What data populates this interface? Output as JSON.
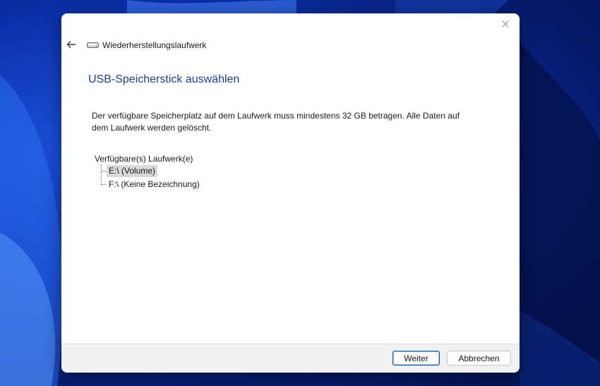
{
  "window": {
    "title": "Wiederherstellungslaufwerk",
    "close_icon": "close-icon",
    "back_icon": "back-arrow-icon",
    "drive_icon": "drive-icon"
  },
  "main": {
    "heading": "USB-Speicherstick auswählen",
    "info": "Der verfügbare Speicherplatz auf dem Laufwerk muss mindestens 32 GB betragen. Alle Daten auf dem Laufwerk werden gelöscht.",
    "drives_label": "Verfügbare(s) Laufwerk(e)",
    "drives": [
      {
        "label": "E:\\ (Volume)",
        "selected": true
      },
      {
        "label": "F:\\ (Keine Bezeichnung)",
        "selected": false
      }
    ]
  },
  "footer": {
    "next_label": "Weiter",
    "cancel_label": "Abbrechen"
  },
  "colors": {
    "heading": "#1c3f95",
    "selection": "#d9d9d9",
    "primary_border": "#0b5cad"
  }
}
